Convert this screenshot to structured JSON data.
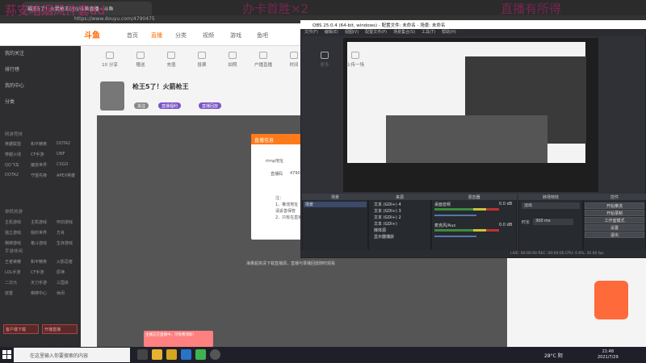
{
  "watermark": {
    "left": "荪安咯烟风件套dd",
    "mid": "办卡首胜×2",
    "right": "直播有所得"
  },
  "browser": {
    "tab_title": "福王5了！火箭枪王(小)/斗鱼直播 - 斗鱼",
    "address": "https://www.douyu.com/4790475",
    "nav": [
      "首页",
      "直播",
      "分类",
      "视频",
      "游戏",
      "鱼吧"
    ],
    "active_nav": "直播"
  },
  "sidebar": {
    "items": [
      "我的关注",
      "排行榜",
      "我的中心",
      "分类"
    ],
    "sec1": "网游竞技",
    "sec1_items": [
      "英雄联盟",
      "和平精英",
      "DOTA2",
      "穿越火线",
      "CF手游",
      "DNF",
      "QQ飞车",
      "魔兽世界",
      "CSGO",
      "DOTA2",
      "守望先锋",
      "APEX英雄"
    ],
    "sec2": "单机热游",
    "sec2_items": [
      "主机游戏",
      "主机游戏",
      "怀旧游戏",
      "独立游戏",
      "我的世界",
      "方舟",
      "棋牌游戏",
      "格斗游戏",
      "生存游戏"
    ],
    "sec3": "手游休闲",
    "sec3_items": [
      "王者荣耀",
      "和平精英",
      "火影忍者",
      "LOL手游",
      "CF手游",
      "原神",
      "二次元",
      "天刀手游",
      "三国杀",
      "放置",
      "棋牌中心",
      "休闲"
    ],
    "btn1": "客户端下载",
    "btn2": "开播直播"
  },
  "toolbar": [
    "10 分享",
    "赠送",
    "充值",
    "投票",
    "拍照",
    "户播直播",
    "时间",
    "更多",
    "上传一场"
  ],
  "room": {
    "title": "枪王5了！火箭枪王",
    "pills": [
      "关注",
      "直播福利",
      "直播回放"
    ]
  },
  "dialog": {
    "title": "直播信息",
    "rtmp_label": "rtmp地址",
    "code_label": "直播码",
    "code_value": "4790475",
    "note_label": "注：",
    "note_lines": [
      "1、推流地址",
      "请妥善保管",
      "2、只有在直播"
    ]
  },
  "below_note": "海量超高清下载直播源，直播与录播回放随时观看",
  "obs": {
    "title": "OBS 25.0.4 (64-bit, windows) - 配置文件: 未命名 - 场景: 未命名",
    "menu": [
      "文件(F)",
      "编辑(E)",
      "视图(V)",
      "配置文件(P)",
      "场景集合(S)",
      "工具(T)",
      "帮助(H)"
    ],
    "docks": {
      "scenes": "场景",
      "sources": "来源",
      "mixer": "混音器",
      "transitions": "转场特效",
      "controls": "控件"
    },
    "scene_item": "场景",
    "sources": [
      "文本 (GDI+) 4",
      "文本 (GDI+) 3",
      "文本 (GDI+) 2",
      "文本 (GDI+)",
      "媒体源",
      "显示器捕获"
    ],
    "mixer": [
      {
        "name": "桌面音频",
        "db": "0.0 dB"
      },
      {
        "name": "麦克风/Aux",
        "db": "0.0 dB"
      }
    ],
    "transition": "淡出",
    "duration_label": "时长",
    "duration_value": "300 ms",
    "controls": [
      "开始推流",
      "开始录制",
      "工作室模式",
      "设置",
      "退出"
    ],
    "status": "LIVE: 00:00:00    REC: 00:00:00    CPU: 0.6%, 30.00 fps"
  },
  "popup": "主播正在直播中，可免费领取！",
  "taskbar": {
    "search": "在这里输入你要搜索的内容",
    "weather": "28°C 阴",
    "time": "21:48",
    "date": "2021/7/29"
  },
  "colors": {
    "accent": "#ff6a00",
    "obs_bg": "#2f3137"
  }
}
